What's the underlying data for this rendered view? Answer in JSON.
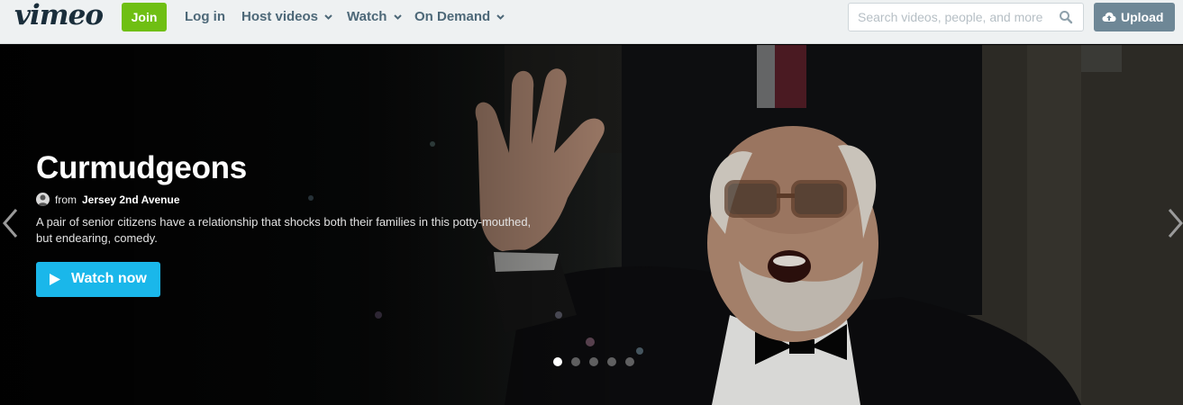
{
  "nav": {
    "logo": "vimeo",
    "join": "Join",
    "login": "Log in",
    "host_videos": "Host videos",
    "watch": "Watch",
    "on_demand": "On Demand",
    "search_placeholder": "Search videos, people, and more",
    "search_icon": "search-icon",
    "upload": "Upload",
    "upload_icon": "cloud-upload-icon",
    "dropdown_icon": "chevron-down-icon"
  },
  "hero": {
    "title": "Curmudgeons",
    "from_label": "from",
    "channel": "Jersey 2nd Avenue",
    "description": "A pair of senior citizens have a relationship that shocks both their families in this potty-mouthed, but endearing, comedy.",
    "watch_label": "Watch now",
    "slides_total": 5,
    "active_slide": 1
  },
  "colors": {
    "nav_bg": "#eef1f2",
    "join_green": "#6fbf13",
    "watch_blue": "#1ab7ea",
    "upload_gray": "#6e8796",
    "nav_text": "#4d6878"
  }
}
